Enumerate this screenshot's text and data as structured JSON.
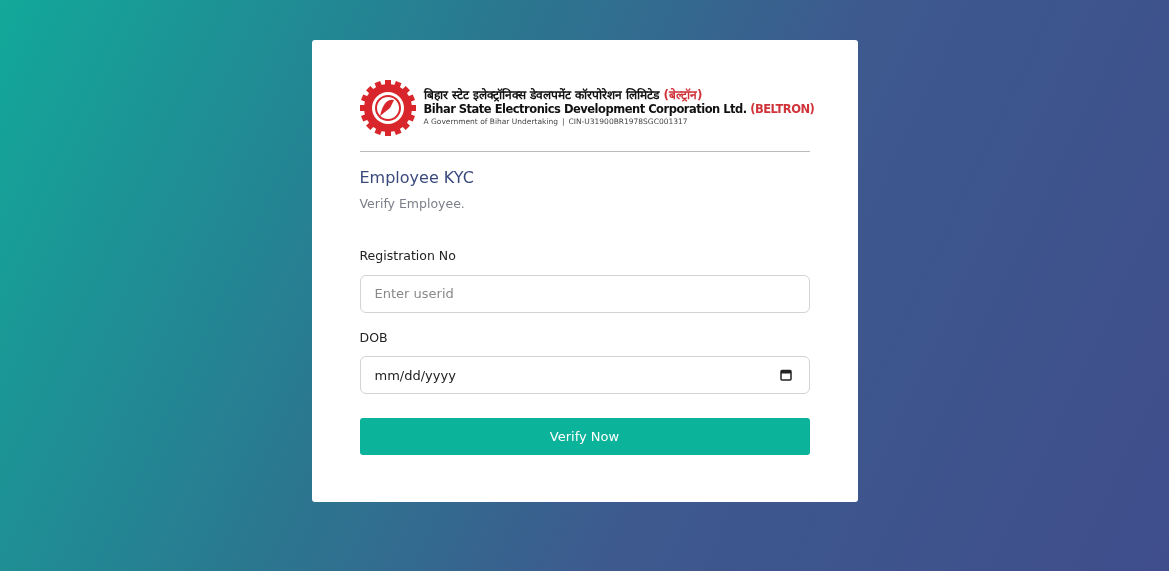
{
  "logo": {
    "hindi_name": "बिहार स्टेट इलेक्ट्रॉनिक्स डेवलपमेंट कॉरपोरेशन लिमिटेड",
    "hindi_short": "(बेल्ट्रॉन)",
    "english_name": "Bihar State Electronics Development Corporation Ltd.",
    "english_short": "(BELTRON)",
    "tagline": "A Government of Bihar Undertaking",
    "separator": "|",
    "cin": "CIN-U31900BR1978SGC001317"
  },
  "title": "Employee KYC",
  "subtitle": "Verify Employee.",
  "fields": [
    {
      "label": "Registration No",
      "placeholder": "Enter userid",
      "kind": "text"
    },
    {
      "label": "DOB",
      "placeholder": "mm/dd/yyyy",
      "kind": "date"
    }
  ],
  "submit": "Verify Now"
}
